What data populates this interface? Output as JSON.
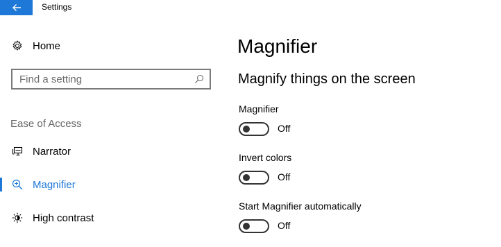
{
  "window": {
    "title": "Settings"
  },
  "sidebar": {
    "home_label": "Home",
    "search": {
      "placeholder": "Find a setting"
    },
    "section_header": "Ease of Access",
    "items": [
      {
        "label": "Narrator",
        "icon": "narrator-icon",
        "active": false
      },
      {
        "label": "Magnifier",
        "icon": "magnifier-icon",
        "active": true
      },
      {
        "label": "High contrast",
        "icon": "high-contrast-icon",
        "active": false
      }
    ]
  },
  "main": {
    "page_title": "Magnifier",
    "subheading": "Magnify things on the screen",
    "settings": [
      {
        "label": "Magnifier",
        "state": "Off"
      },
      {
        "label": "Invert colors",
        "state": "Off"
      },
      {
        "label": "Start Magnifier automatically",
        "state": "Off"
      }
    ]
  },
  "colors": {
    "accent": "#1e78d7",
    "text": "#000000",
    "secondary_text": "#666666",
    "border": "#7a7a7a"
  }
}
